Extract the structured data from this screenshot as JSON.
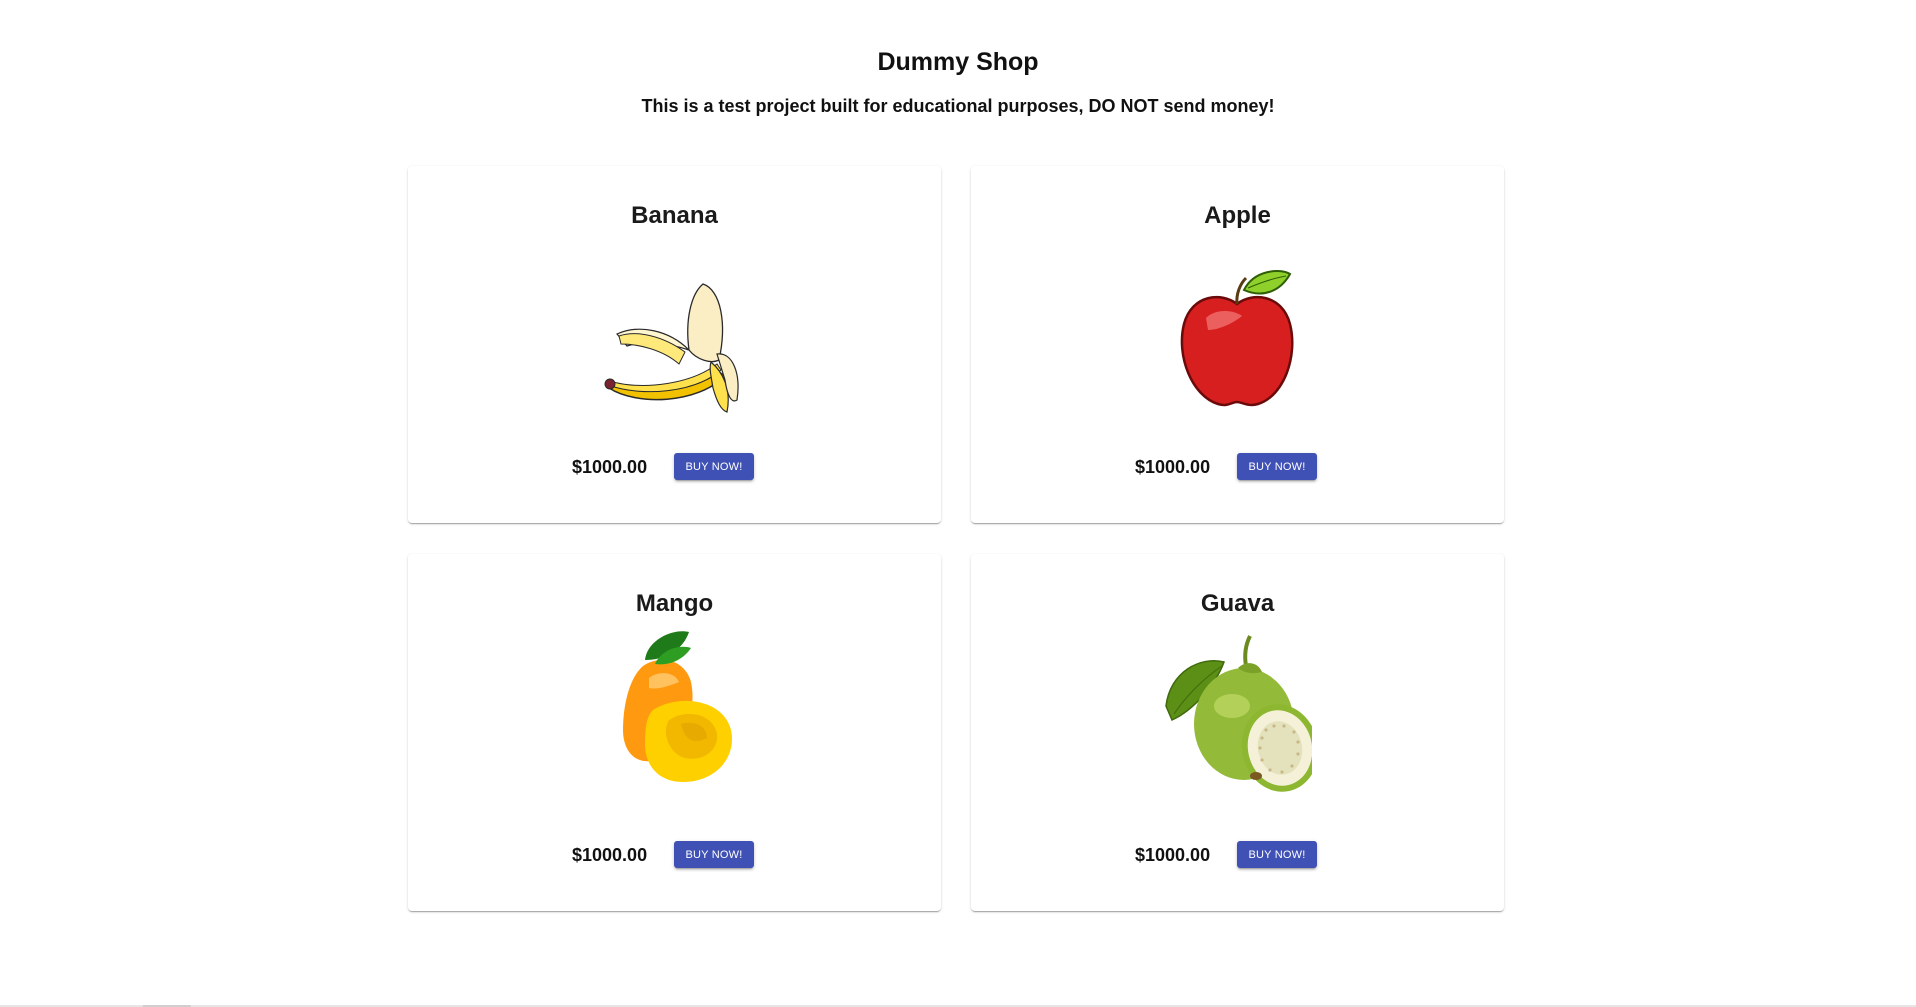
{
  "header": {
    "title": "Dummy Shop",
    "subtitle": "This is a test project built for educational purposes, DO NOT send money!"
  },
  "products": [
    {
      "name": "Banana",
      "price": "$1000.00",
      "button": "BUY NOW!",
      "image_icon": "banana-image"
    },
    {
      "name": "Apple",
      "price": "$1000.00",
      "button": "BUY NOW!",
      "image_icon": "apple-image"
    },
    {
      "name": "Mango",
      "price": "$1000.00",
      "button": "BUY NOW!",
      "image_icon": "mango-image"
    },
    {
      "name": "Guava",
      "price": "$1000.00",
      "button": "BUY NOW!",
      "image_icon": "guava-image"
    }
  ],
  "colors": {
    "button_bg": "#3f51b5",
    "button_text": "#ffffff",
    "page_bg": "#ffffff"
  }
}
